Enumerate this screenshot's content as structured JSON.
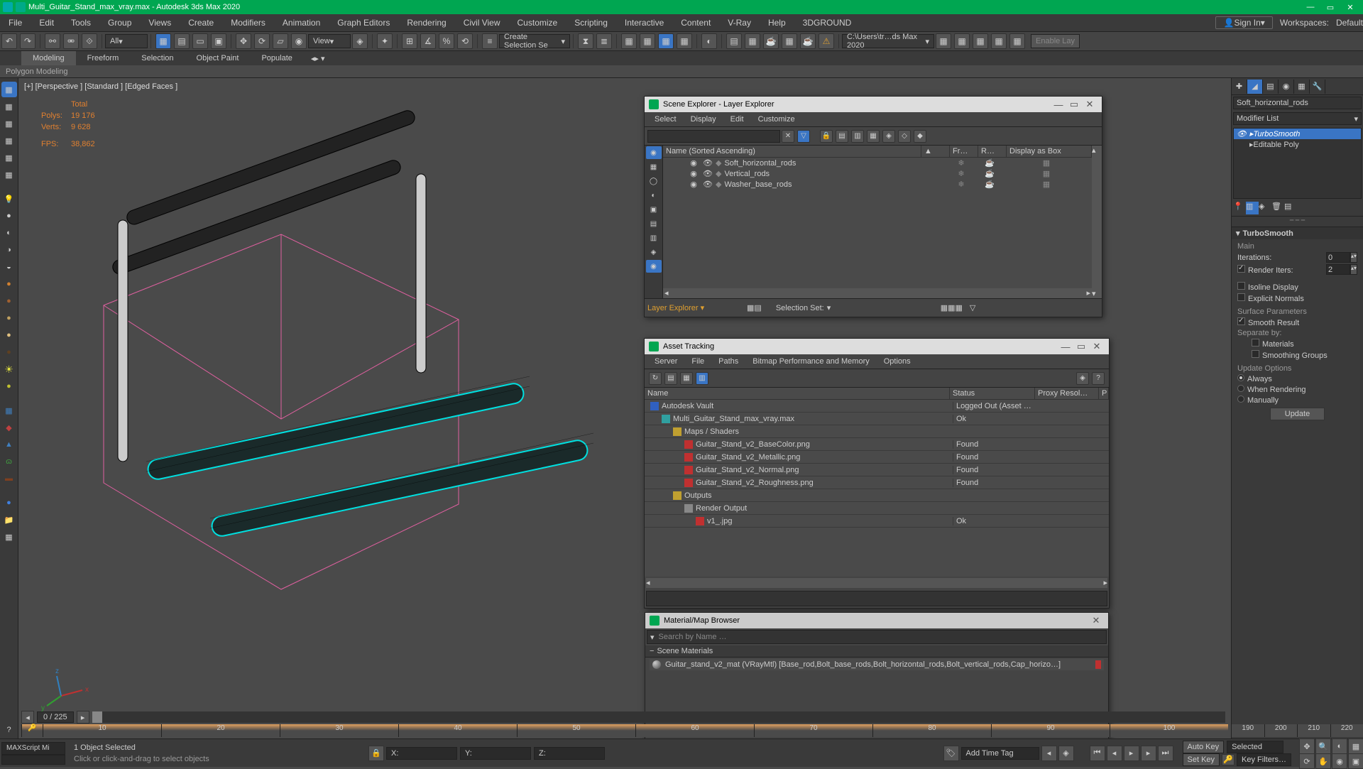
{
  "title": "Multi_Guitar_Stand_max_vray.max - Autodesk 3ds Max 2020",
  "menu": [
    "File",
    "Edit",
    "Tools",
    "Group",
    "Views",
    "Create",
    "Modifiers",
    "Animation",
    "Graph Editors",
    "Rendering",
    "Civil View",
    "Customize",
    "Scripting",
    "Interactive",
    "Content",
    "V-Ray",
    "Help",
    "3DGROUND"
  ],
  "signin": "Sign In",
  "workspaces_lbl": "Workspaces:",
  "workspaces_val": "Default",
  "toolbar": {
    "all": "All",
    "view": "View",
    "sel": "Create Selection Se",
    "path": "C:\\Users\\tr…ds Max 2020"
  },
  "enable_layer": "Enable Lay",
  "ribbon": [
    "Modeling",
    "Freeform",
    "Selection",
    "Object Paint",
    "Populate"
  ],
  "ribbon2": "Polygon Modeling",
  "viewport_label": "[+] [Perspective ] [Standard ] [Edged Faces ]",
  "stats": {
    "hdr": "Total",
    "polys_lbl": "Polys:",
    "polys": "19 176",
    "verts_lbl": "Verts:",
    "verts": "9 628",
    "fps_lbl": "FPS:",
    "fps": "38,862"
  },
  "right": {
    "objname": "Soft_horizontal_rods",
    "modlist": "Modifier List",
    "stack": [
      {
        "n": "TurboSmooth",
        "sel": true
      },
      {
        "n": "Editable Poly",
        "sel": false
      }
    ],
    "roll": "TurboSmooth",
    "main": "Main",
    "iter_lbl": "Iterations:",
    "iter": "0",
    "rend_lbl": "Render Iters:",
    "rend": "2",
    "iso": "Isoline Display",
    "expn": "Explicit Normals",
    "surf": "Surface Parameters",
    "smooth": "Smooth Result",
    "sep": "Separate by:",
    "mat": "Materials",
    "sg": "Smoothing Groups",
    "upd": "Update Options",
    "always": "Always",
    "wren": "When Rendering",
    "man": "Manually",
    "updbtn": "Update"
  },
  "scene_explorer": {
    "title": "Scene Explorer - Layer Explorer",
    "menu": [
      "Select",
      "Display",
      "Edit",
      "Customize"
    ],
    "cols": [
      "Name (Sorted Ascending)",
      "Fr…",
      "R…",
      "Display as Box"
    ],
    "rows": [
      {
        "n": "Soft_horizontal_rods"
      },
      {
        "n": "Vertical_rods"
      },
      {
        "n": "Washer_base_rods"
      }
    ],
    "footer": "Layer Explorer",
    "selset": "Selection Set:"
  },
  "asset_tracking": {
    "title": "Asset Tracking",
    "menu": [
      "Server",
      "File",
      "Paths",
      "Bitmap Performance and Memory",
      "Options"
    ],
    "cols": [
      "Name",
      "Status",
      "Proxy Resol…",
      "P"
    ],
    "rows": [
      {
        "n": "Autodesk Vault",
        "st": "Logged Out (Asset …",
        "i": "fi-blue",
        "ind": 0
      },
      {
        "n": "Multi_Guitar_Stand_max_vray.max",
        "st": "Ok",
        "i": "fi-cyan",
        "ind": 1
      },
      {
        "n": "Maps / Shaders",
        "st": "",
        "i": "fi-yel",
        "ind": 2
      },
      {
        "n": "Guitar_Stand_v2_BaseColor.png",
        "st": "Found",
        "i": "fi-red",
        "ind": 3
      },
      {
        "n": "Guitar_Stand_v2_Metallic.png",
        "st": "Found",
        "i": "fi-red",
        "ind": 3
      },
      {
        "n": "Guitar_Stand_v2_Normal.png",
        "st": "Found",
        "i": "fi-red",
        "ind": 3
      },
      {
        "n": "Guitar_Stand_v2_Roughness.png",
        "st": "Found",
        "i": "fi-red",
        "ind": 3
      },
      {
        "n": "Outputs",
        "st": "",
        "i": "fi-yel",
        "ind": 2
      },
      {
        "n": "Render Output",
        "st": "",
        "i": "fi-grey",
        "ind": 3
      },
      {
        "n": "v1_.jpg",
        "st": "Ok",
        "i": "fi-red",
        "ind": 4
      }
    ]
  },
  "material_browser": {
    "title": "Material/Map Browser",
    "search": "Search by Name …",
    "section": "Scene Materials",
    "item": "Guitar_stand_v2_mat (VRayMtl) [Base_rod,Bolt_base_rods,Bolt_horizontal_rods,Bolt_vertical_rods,Cap_horizo…]"
  },
  "timeline": {
    "frame": "0 / 225",
    "ticks": [
      "10",
      "20",
      "30",
      "40",
      "50",
      "60",
      "70",
      "80",
      "90",
      "100"
    ],
    "rticks": [
      "190",
      "200",
      "210",
      "220"
    ]
  },
  "status": {
    "script": "MAXScript Mi",
    "sel": "1 Object Selected",
    "hint": "Click or click-and-drag to select objects",
    "addtime": "Add Time Tag",
    "autokey": "Auto Key",
    "selected": "Selected",
    "setkey": "Set Key",
    "keyfilt": "Key Filters…"
  },
  "coords": {
    "x": "X:",
    "y": "Y:",
    "z": "Z:"
  }
}
